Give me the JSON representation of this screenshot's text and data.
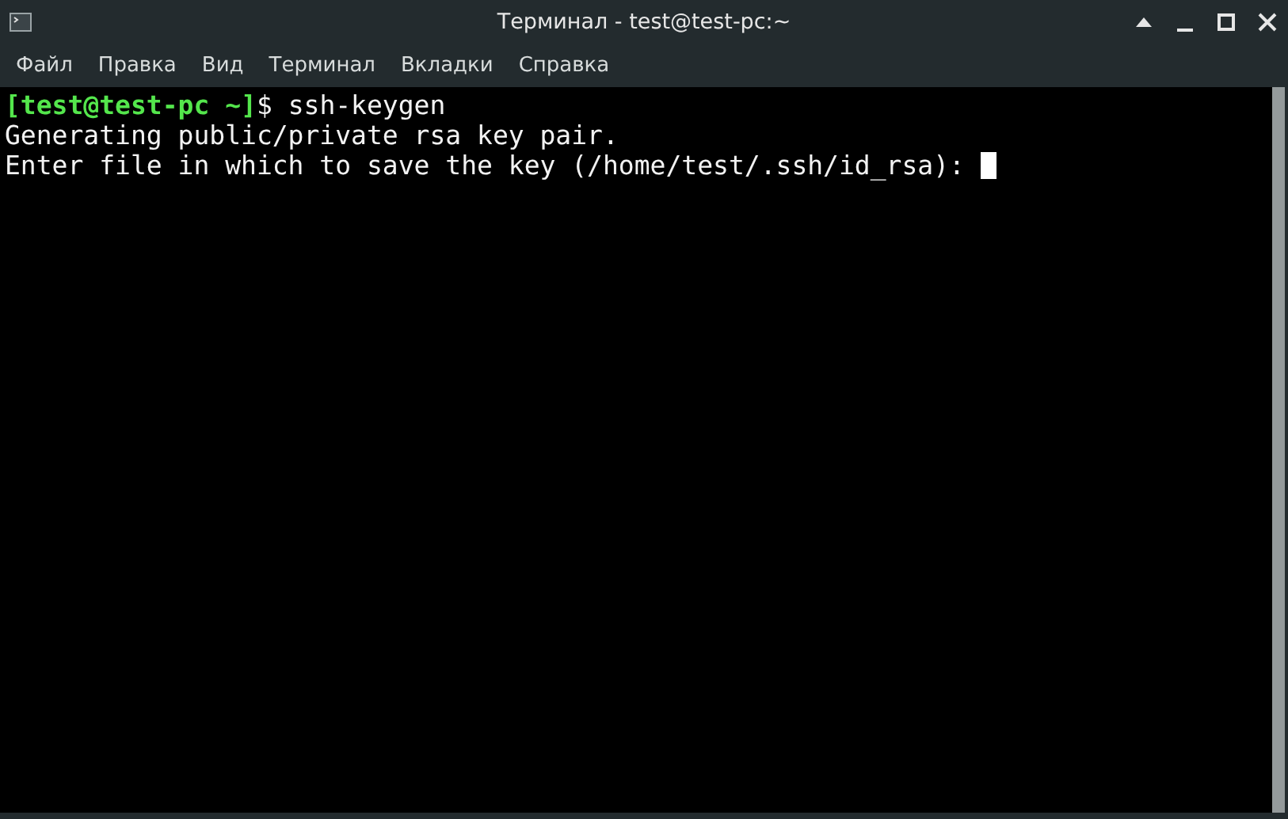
{
  "window": {
    "title": "Терминал - test@test-pc:~"
  },
  "menu": [
    "Файл",
    "Правка",
    "Вид",
    "Терминал",
    "Вкладки",
    "Справка"
  ],
  "terminal": {
    "lines": [
      {
        "segments": [
          {
            "kind": "prompt",
            "text": "[test@test-pc ~]"
          },
          {
            "kind": "plain",
            "text": "$ ssh-keygen"
          }
        ]
      },
      {
        "segments": [
          {
            "kind": "plain",
            "text": "Generating public/private rsa key pair."
          }
        ]
      },
      {
        "segments": [
          {
            "kind": "plain",
            "text": "Enter file in which to save the key (/home/test/.ssh/id_rsa): "
          }
        ],
        "cursor": true
      }
    ]
  }
}
